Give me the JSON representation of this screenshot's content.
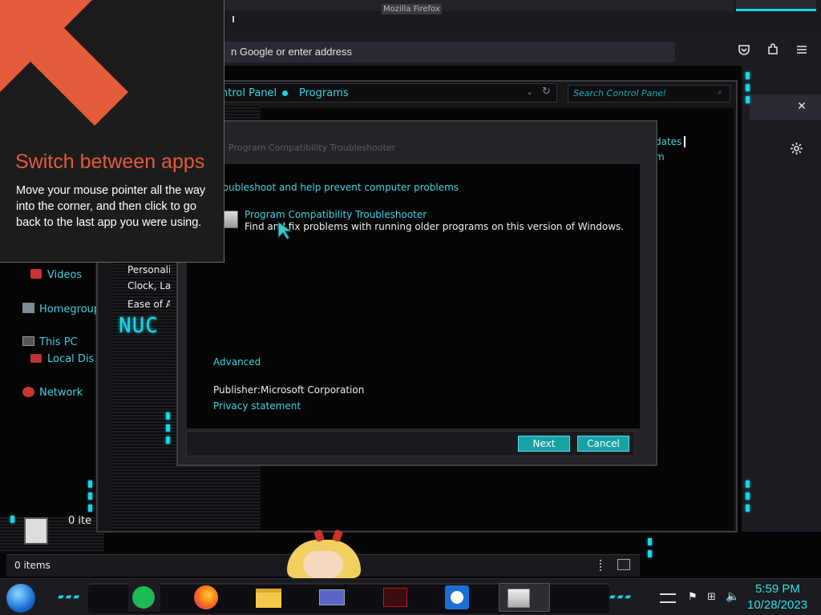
{
  "firefox": {
    "window_title": "Mozilla Firefox",
    "address_placeholder": "n Google or enter address"
  },
  "control_panel": {
    "breadcrumb": [
      "ntrol Panel",
      "Programs"
    ],
    "search_placeholder": "Search Control Panel",
    "right_links": [
      "dates",
      "m"
    ],
    "nav_items": [
      "Personaliz",
      "Clock, Lar",
      "Ease of Ac"
    ],
    "left_pane": {
      "videos": "Videos",
      "homegroup": "Homegroup",
      "this_pc": "This PC",
      "local_disk": "Local Dis",
      "network": "Network"
    },
    "items_count_small": "0 ite",
    "status_items": "0 items"
  },
  "dialog": {
    "title": "Program Compatibility Troubleshooter",
    "heading": "roubleshoot and help prevent computer problems",
    "item_title": "Program Compatibility Troubleshooter",
    "item_desc": "Find and fix problems with running older programs on this version of Windows.",
    "advanced": "Advanced",
    "publisher_label": "Publisher:",
    "publisher_value": "Microsoft Corporation",
    "privacy": "Privacy statement",
    "next": "Next",
    "cancel": "Cancel"
  },
  "tip": {
    "title": "Switch between apps",
    "text": "Move your mouse pointer all the way into the corner, and then click to go back to the last app you were using."
  },
  "taskbar": {
    "apps": [
      "start-orb",
      "notes-app",
      "firefox",
      "file-explorer",
      "control-panel",
      "media-app",
      "weather-app",
      "troubleshooter"
    ],
    "clock_time": "5:59 PM",
    "clock_date": "10/28/2023"
  },
  "colors": {
    "accent": "#19d6e6",
    "tip_title": "#e35b3b",
    "link": "#3fd1e3",
    "button": "#18a2a6"
  }
}
